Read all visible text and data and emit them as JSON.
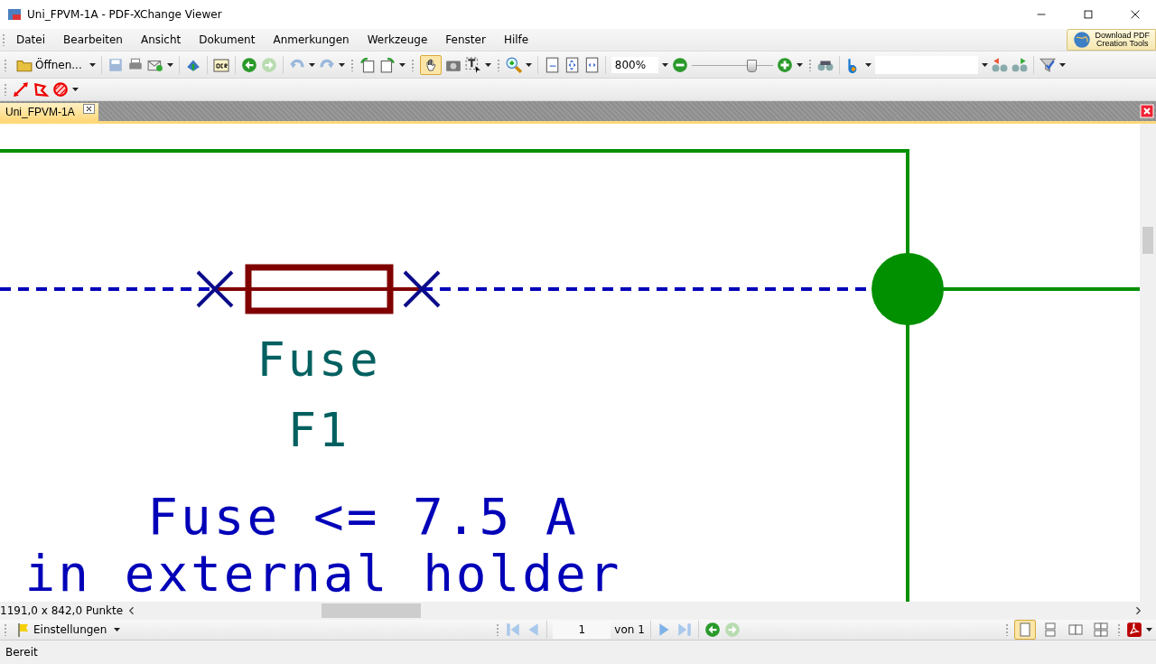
{
  "window": {
    "title": "Uni_FPVM-1A - PDF-XChange Viewer"
  },
  "menu": [
    {
      "label": "Datei"
    },
    {
      "label": "Bearbeiten"
    },
    {
      "label": "Ansicht"
    },
    {
      "label": "Dokument"
    },
    {
      "label": "Anmerkungen"
    },
    {
      "label": "Werkzeuge"
    },
    {
      "label": "Fenster"
    },
    {
      "label": "Hilfe"
    }
  ],
  "promo": {
    "lines": [
      "Download PDF",
      "Creation Tools"
    ]
  },
  "toolbar": {
    "open_label": "Öffnen...",
    "hand_tool_selected": true,
    "zoom_value": "800%",
    "zoom_slider": {
      "level": 0.72
    }
  },
  "tabs": [
    {
      "label": "Uni_FPVM-1A",
      "selected": true
    }
  ],
  "document": {
    "labels": [
      {
        "text": "Fuse",
        "kind": "value"
      },
      {
        "text": "F1",
        "kind": "reference"
      },
      {
        "text": "Fuse <= 7.5 A",
        "kind": "note"
      },
      {
        "text": "in external holder",
        "kind": "note"
      }
    ]
  },
  "page_size": "1191,0 x 842,0 Punkte",
  "settings": {
    "label": "Einstellungen"
  },
  "page_nav": {
    "page": "1",
    "total": "von 1"
  },
  "view_modes": [
    {
      "selected": true
    },
    {
      "selected": false
    },
    {
      "selected": false
    },
    {
      "selected": false
    }
  ],
  "status_bar": "Bereit"
}
